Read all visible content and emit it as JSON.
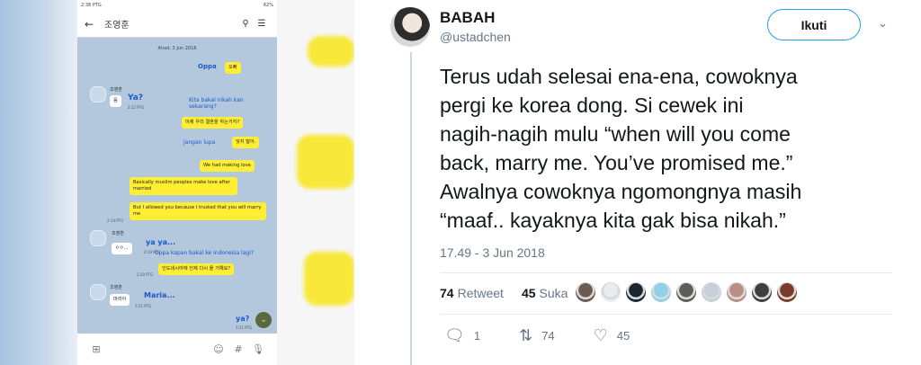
{
  "screenshot": {
    "status_time": "2:38 PTG",
    "battery": "62%",
    "contact_name": "조영훈",
    "date_label": "Ahad, 3 Jun 2018",
    "messages": [
      {
        "side": "right",
        "overlay": "Oppa",
        "text": "오빠",
        "time": ""
      },
      {
        "side": "left",
        "sender": "조영훈",
        "text": "응",
        "overlay": "Ya?",
        "time": "2:12 PTG"
      },
      {
        "side": "right",
        "overlay": "Kita bakal nikah kan sekarang?",
        "text": "이제 우리 결혼을 하는거지?",
        "time": ""
      },
      {
        "side": "right",
        "overlay": "jangan lupa",
        "text": "잊지 말아.",
        "time": ""
      },
      {
        "side": "right",
        "text": "We had making love",
        "time": ""
      },
      {
        "side": "right",
        "text": "Basically muslim peoples make love after married",
        "time": ""
      },
      {
        "side": "right",
        "text": "But I allowed you because I trusted that you will marry me",
        "time": "2:14 PTG"
      },
      {
        "side": "left",
        "sender": "조영훈",
        "text": "ㅇㅇ...",
        "overlay": "ya ya...",
        "time": "2:19 PTG"
      },
      {
        "side": "right",
        "overlay": "Oppa kapan bakal ke Indonesia lagi?",
        "text": "인도네시아에 언제 다시 올 거예요?",
        "time": "2:20 PTG"
      },
      {
        "side": "left",
        "sender": "조영훈",
        "text": "마리아",
        "overlay": "Maria...",
        "time": "2:21 PTG"
      },
      {
        "side": "right",
        "overlay": "ya?",
        "text": "",
        "time": "2:21 PTG"
      }
    ]
  },
  "tweet": {
    "name": "BABAH",
    "handle": "@ustadchen",
    "follow_label": "Ikuti",
    "text": "Terus udah selesai ena-ena, cowoknya\npergi ke korea dong. Si cewek ini\nnagih-nagih mulu “when will you come\nback, marry me. You’ve promised me.”\nAwalnya  cowoknya ngomongnya masih\n“maaf.. kayaknya kita gak bisa nikah.”",
    "timestamp": "17.49 - 3 Jun 2018",
    "retweet_count": "74",
    "retweet_label": "Retweet",
    "like_count": "45",
    "like_label": "Suka",
    "reply_count": "1",
    "action_retweet_count": "74",
    "action_like_count": "45",
    "liker_colors": [
      "#6b5b52",
      "#e9ecef",
      "#1d2733",
      "#8fd0ea",
      "#5d5e56",
      "#c7d0d8",
      "#b98e83",
      "#403d3c",
      "#7a3b2a"
    ]
  },
  "colors": {
    "accent": "#1da1f2",
    "text": "#14171a",
    "muted": "#657786",
    "bubble_yellow": "#ffee33",
    "chat_bg": "#b3c8dd"
  },
  "icons": {
    "reply": "reply-icon",
    "retweet": "retweet-icon",
    "like": "heart-icon",
    "caret": "chevron-down-icon"
  }
}
